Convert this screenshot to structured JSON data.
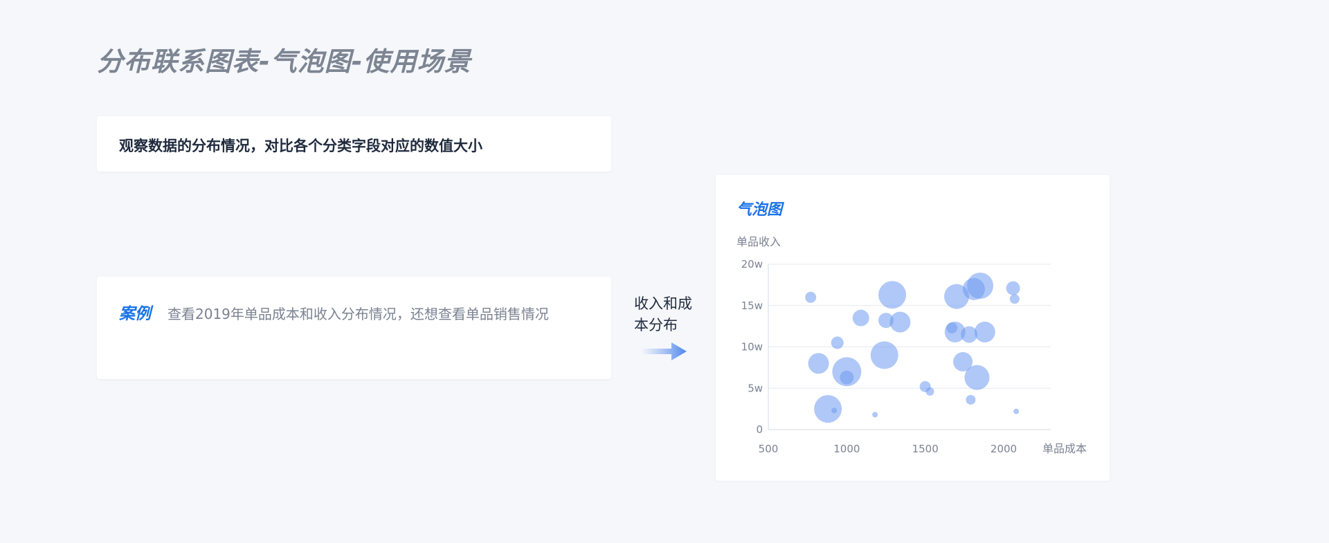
{
  "page": {
    "title": "分布联系图表-气泡图-使用场景"
  },
  "description": {
    "text": "观察数据的分布情况，对比各个分类字段对应的数值大小"
  },
  "case": {
    "label": "案例",
    "text": "查看2019年单品成本和收入分布情况，还想查看单品销售情况"
  },
  "arrow": {
    "label": "收入和成本分布",
    "icon": "arrow-right-icon"
  },
  "chart_card": {
    "title": "气泡图"
  },
  "colors": {
    "bubble": "#6f9bf0",
    "accent": "#1a74e8",
    "grid": "#e6e9ef",
    "axis_text": "#7a8291"
  },
  "chart_data": {
    "type": "scatter",
    "title": "气泡图",
    "xlabel": "单品成本",
    "ylabel": "单品收入",
    "xlim": [
      500,
      2300
    ],
    "ylim": [
      0,
      20
    ],
    "x_ticks": [
      500,
      1000,
      1500,
      2000
    ],
    "x_tick_labels": [
      "500",
      "1000",
      "1500",
      "2000"
    ],
    "y_ticks": [
      0,
      5,
      10,
      15,
      20
    ],
    "y_tick_labels": [
      "0",
      "5w",
      "10w",
      "15w",
      "20w"
    ],
    "grid": true,
    "points": [
      {
        "x": 770,
        "y": 16,
        "size": 8
      },
      {
        "x": 820,
        "y": 8,
        "size": 15
      },
      {
        "x": 880,
        "y": 2.5,
        "size": 20
      },
      {
        "x": 920,
        "y": 2.3,
        "size": 4
      },
      {
        "x": 940,
        "y": 10.5,
        "size": 9
      },
      {
        "x": 1000,
        "y": 7,
        "size": 21
      },
      {
        "x": 1000,
        "y": 6.3,
        "size": 10
      },
      {
        "x": 1090,
        "y": 13.5,
        "size": 12
      },
      {
        "x": 1180,
        "y": 1.8,
        "size": 4
      },
      {
        "x": 1240,
        "y": 9,
        "size": 20
      },
      {
        "x": 1250,
        "y": 13.2,
        "size": 11
      },
      {
        "x": 1290,
        "y": 16.3,
        "size": 20
      },
      {
        "x": 1340,
        "y": 13,
        "size": 15
      },
      {
        "x": 1500,
        "y": 5.2,
        "size": 8
      },
      {
        "x": 1530,
        "y": 4.6,
        "size": 6
      },
      {
        "x": 1670,
        "y": 12.3,
        "size": 8
      },
      {
        "x": 1690,
        "y": 11.8,
        "size": 15
      },
      {
        "x": 1700,
        "y": 16.1,
        "size": 18
      },
      {
        "x": 1740,
        "y": 8.2,
        "size": 14
      },
      {
        "x": 1780,
        "y": 11.5,
        "size": 12
      },
      {
        "x": 1790,
        "y": 3.6,
        "size": 7
      },
      {
        "x": 1810,
        "y": 17,
        "size": 16
      },
      {
        "x": 1830,
        "y": 6.3,
        "size": 18
      },
      {
        "x": 1850,
        "y": 17.4,
        "size": 19
      },
      {
        "x": 1880,
        "y": 11.8,
        "size": 15
      },
      {
        "x": 2060,
        "y": 17.1,
        "size": 10
      },
      {
        "x": 2070,
        "y": 15.8,
        "size": 7
      },
      {
        "x": 2080,
        "y": 2.2,
        "size": 4
      }
    ]
  }
}
